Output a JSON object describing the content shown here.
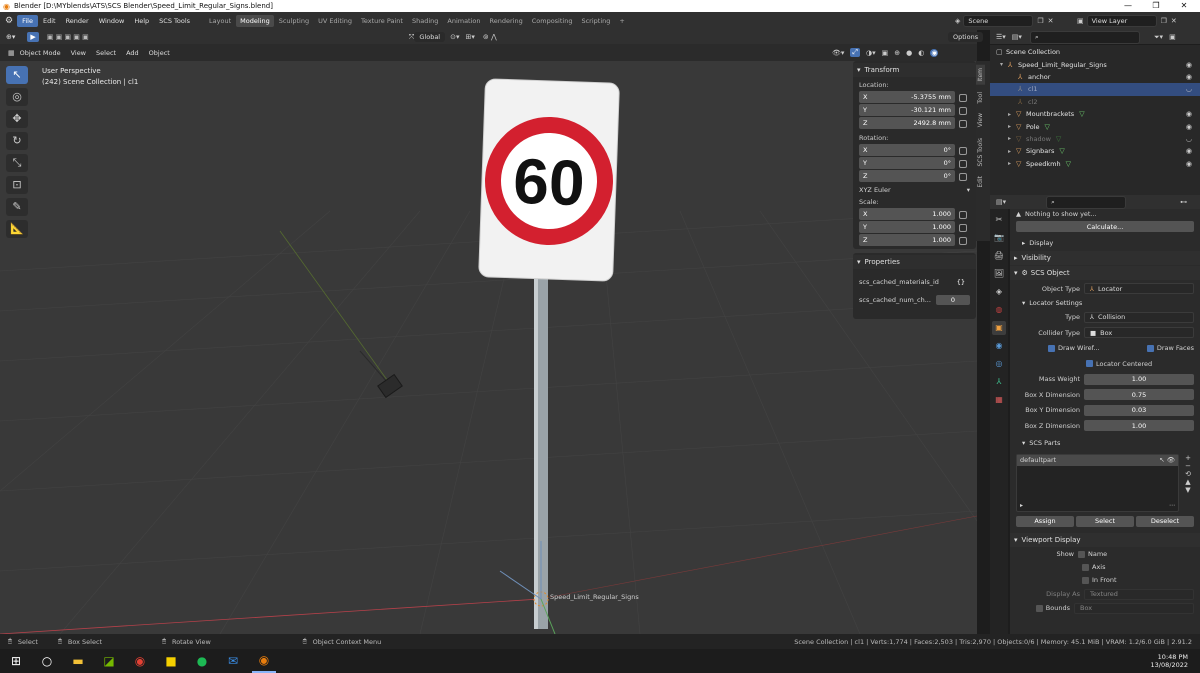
{
  "window": {
    "title": "Blender [D:\\MYblends\\ATS\\SCS Blender\\Speed_Limit_Regular_Signs.blend]",
    "minimize": "—",
    "maximize": "❐",
    "close": "✕"
  },
  "menu": [
    "File",
    "Edit",
    "Render",
    "Window",
    "Help",
    "SCS Tools"
  ],
  "workspaces": [
    "Layout",
    "Modeling",
    "Sculpting",
    "UV Editing",
    "Texture Paint",
    "Shading",
    "Animation",
    "Rendering",
    "Compositing",
    "Scripting"
  ],
  "workspace_add": "+",
  "scene": {
    "name": "Scene",
    "view_layer": "View Layer"
  },
  "viewport_header": {
    "transform_orientation": "Global",
    "options": "Options"
  },
  "viewport_menu": [
    "Object Mode",
    "View",
    "Select",
    "Add",
    "Object"
  ],
  "viewport": {
    "perspective": "User Perspective",
    "collection": "(242) Scene Collection | cl1",
    "sign_text": "60",
    "origin_label": "Speed_Limit_Regular_Signs"
  },
  "npanel": {
    "transform_title": "Transform",
    "location_label": "Location:",
    "location": [
      [
        "X",
        "-5.3755 mm"
      ],
      [
        "Y",
        "-30.121 mm"
      ],
      [
        "Z",
        "2492.8 mm"
      ]
    ],
    "rotation_label": "Rotation:",
    "rotation": [
      [
        "X",
        "0°"
      ],
      [
        "Y",
        "0°"
      ],
      [
        "Z",
        "0°"
      ]
    ],
    "rotation_mode": "XYZ Euler",
    "scale_label": "Scale:",
    "scale": [
      [
        "X",
        "1.000"
      ],
      [
        "Y",
        "1.000"
      ],
      [
        "Z",
        "1.000"
      ]
    ],
    "properties_title": "Properties",
    "props": [
      [
        "scs_cached_materials_id",
        "{}"
      ],
      [
        "scs_cached_num_ch...",
        "0"
      ]
    ]
  },
  "sidetabs": [
    "Item",
    "Tool",
    "View",
    "SCS Tools",
    "Edit"
  ],
  "outliner": {
    "root": "Scene Collection",
    "rows": [
      {
        "name": "Speed_Limit_Regular_Signs",
        "level": 1,
        "sel": false,
        "eye": "◉",
        "expanded": true
      },
      {
        "name": "anchor",
        "level": 2,
        "sel": false,
        "eye": "◉"
      },
      {
        "name": "cl1",
        "level": 2,
        "sel": true,
        "eye": "◡"
      },
      {
        "name": "cl2",
        "level": 2,
        "sel": false,
        "eye": ""
      },
      {
        "name": "Mountbrackets",
        "level": 2,
        "sel": false,
        "eye": "◉",
        "mesh": true
      },
      {
        "name": "Pole",
        "level": 2,
        "sel": false,
        "eye": "◉",
        "mesh": true
      },
      {
        "name": "shadow",
        "level": 2,
        "sel": false,
        "eye": "◡",
        "mesh": true
      },
      {
        "name": "Signbars",
        "level": 2,
        "sel": false,
        "eye": "◉",
        "mesh": true
      },
      {
        "name": "Speedkmh",
        "level": 2,
        "sel": false,
        "eye": "◉",
        "mesh": true
      }
    ]
  },
  "properties": {
    "nothing": "Nothing to show yet...",
    "calculate": "Calculate...",
    "display": "Display",
    "visibility": "Visibility",
    "scs_object": "SCS Object",
    "object_type_label": "Object Type",
    "object_type": "Locator",
    "locator_settings": "Locator Settings",
    "type_label": "Type",
    "type": "Collision",
    "collider_type_label": "Collider Type",
    "collider_type": "Box",
    "draw_wiref": "Draw Wiref...",
    "draw_faces": "Draw Faces",
    "locator_centered": "Locator Centered",
    "mass_weight_label": "Mass Weight",
    "mass_weight": "1.00",
    "box_x_label": "Box X Dimension",
    "box_x": "0.75",
    "box_y_label": "Box Y Dimension",
    "box_y": "0.03",
    "box_z_label": "Box Z Dimension",
    "box_z": "1.00",
    "scs_parts": "SCS Parts",
    "part": "defaultpart",
    "assign": "Assign",
    "select": "Select",
    "deselect": "Deselect",
    "viewport_display": "Viewport Display",
    "show_label": "Show",
    "show_name": "Name",
    "show_axis": "Axis",
    "show_infront": "In Front",
    "display_as_label": "Display As",
    "display_as": "Textured",
    "bounds_label": "Bounds",
    "bounds": "Box"
  },
  "status": {
    "select": "Select",
    "box_select": "Box Select",
    "rotate_view": "Rotate View",
    "context_menu": "Object Context Menu",
    "stats": "Scene Collection | cl1 | Verts:1,774 | Faces:2,503 | Tris:2,970 | Objects:0/6 | Memory: 45.1 MiB | VRAM: 1.2/6.0 GiB | 2.91.2"
  },
  "taskbar": {
    "time": "10:48 PM",
    "date": "13/08/2022",
    "icons": [
      "windows-icon",
      "search-icon",
      "file-explorer-icon",
      "nvidia-icon",
      "chrome-icon",
      "sticky-notes-icon",
      "spotify-icon",
      "mail-icon",
      "blender-icon"
    ]
  },
  "colors": {
    "accent": "#4772b3",
    "sign_red": "#d3202f",
    "object_orange": "#f0a040",
    "mesh_green": "#6fd36f"
  }
}
